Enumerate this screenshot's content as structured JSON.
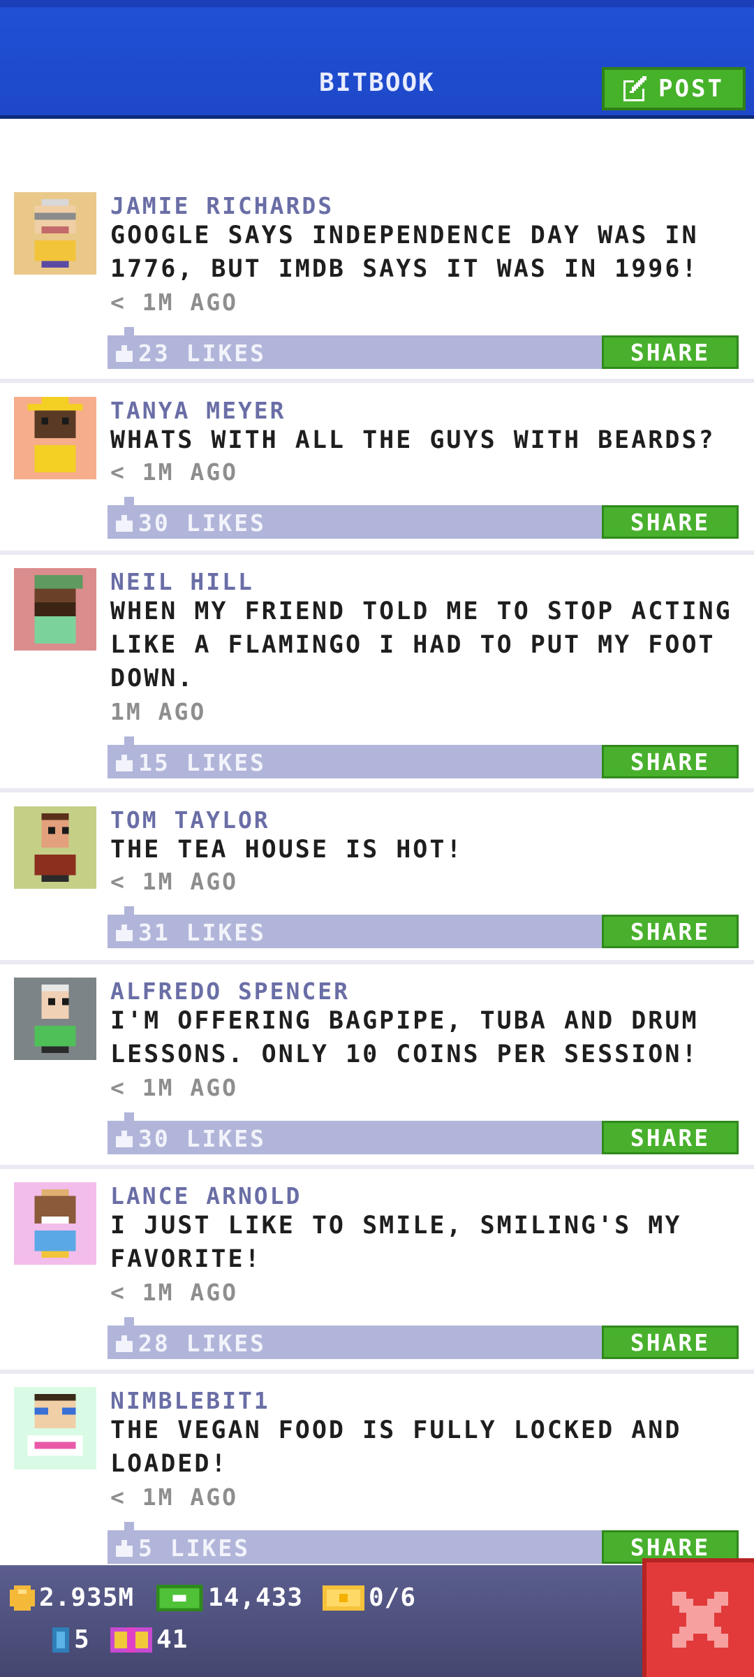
{
  "header": {
    "title": "BITBOOK",
    "post_label": "POST"
  },
  "posts": [
    {
      "name": "JAMIE RICHARDS",
      "lines": [
        "GOOGLE SAYS INDEPENDENCE DAY WAS IN",
        "1776, BUT IMDB SAYS IT WAS IN 1996!"
      ],
      "time": "< 1M AGO",
      "likes": "23 LIKES",
      "share": "SHARE",
      "avatar_bg": "#e9c88a"
    },
    {
      "name": "TANYA MEYER",
      "lines": [
        "WHATS WITH ALL THE GUYS WITH BEARDS?"
      ],
      "time": "< 1M AGO",
      "likes": "30 LIKES",
      "share": "SHARE",
      "avatar_bg": "#f6ad8b"
    },
    {
      "name": "NEIL HILL",
      "lines": [
        "WHEN MY FRIEND TOLD ME TO STOP ACTING",
        "LIKE A FLAMINGO I HAD TO PUT MY FOOT",
        "DOWN."
      ],
      "time": "1M AGO",
      "likes": "15 LIKES",
      "share": "SHARE",
      "avatar_bg": "#db8c8c"
    },
    {
      "name": "TOM TAYLOR",
      "lines": [
        "THE TEA HOUSE IS HOT!"
      ],
      "time": "< 1M AGO",
      "likes": "31 LIKES",
      "share": "SHARE",
      "avatar_bg": "#c5cf86"
    },
    {
      "name": "ALFREDO SPENCER",
      "lines": [
        "I'M OFFERING BAGPIPE, TUBA AND DRUM",
        "LESSONS. ONLY 10 COINS PER SESSION!"
      ],
      "time": "< 1M AGO",
      "likes": "30 LIKES",
      "share": "SHARE",
      "avatar_bg": "#7d8487"
    },
    {
      "name": "LANCE ARNOLD",
      "lines": [
        "I JUST LIKE TO SMILE, SMILING'S MY",
        "FAVORITE!"
      ],
      "time": "< 1M AGO",
      "likes": "28 LIKES",
      "share": "SHARE",
      "avatar_bg": "#f2bdea"
    },
    {
      "name": "NIMBLEBIT1",
      "lines": [
        "THE VEGAN FOOD IS FULLY LOCKED AND",
        "LOADED!"
      ],
      "time": "< 1M AGO",
      "likes": "5 LIKES",
      "share": "SHARE",
      "avatar_bg": "#d9fbe6"
    }
  ],
  "status": {
    "coins": "2.935M",
    "bux": "14,433",
    "tickets": "0/6",
    "keys": "5",
    "gifts": "41"
  },
  "colors": {
    "header_blue": "#1d48c8",
    "name_purple": "#6a6ea6",
    "likes_bar": "#b1b5d9",
    "share_green": "#48b02c",
    "close_red": "#e23a3a"
  }
}
